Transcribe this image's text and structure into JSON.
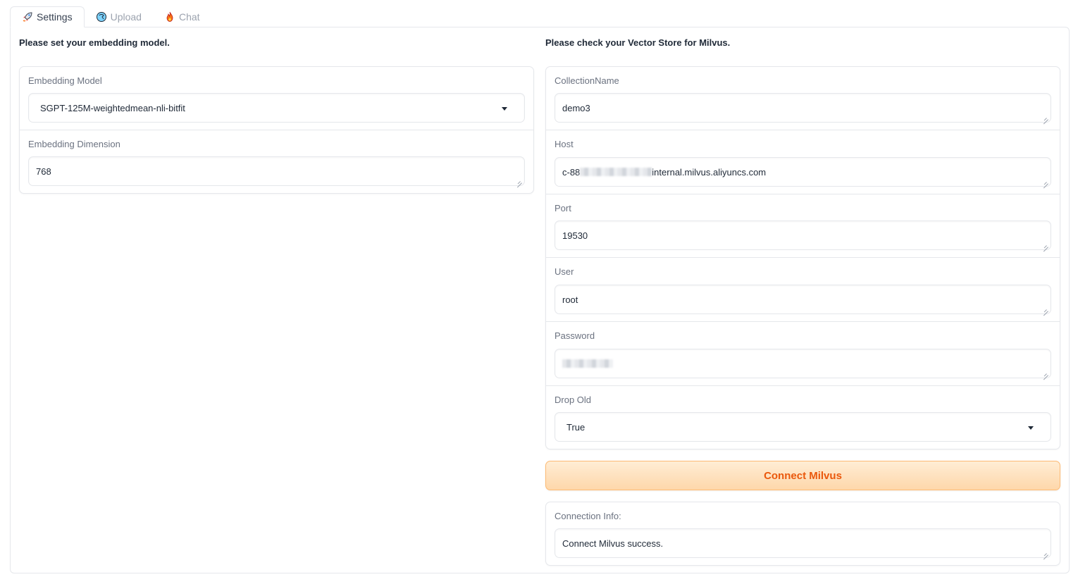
{
  "tabs": [
    {
      "label": "Settings",
      "icon": "rocket-icon",
      "active": true
    },
    {
      "label": "Upload",
      "icon": "upload-icon",
      "active": false
    },
    {
      "label": "Chat",
      "icon": "fire-icon",
      "active": false
    }
  ],
  "left": {
    "heading": "Please set your embedding model.",
    "embedding_model": {
      "label": "Embedding Model",
      "value": "SGPT-125M-weightedmean-nli-bitfit"
    },
    "embedding_dimension": {
      "label": "Embedding Dimension",
      "value": "768"
    }
  },
  "right": {
    "heading": "Please check your Vector Store for Milvus.",
    "collection_name": {
      "label": "CollectionName",
      "value": "demo3"
    },
    "host": {
      "label": "Host",
      "value_prefix": "c-88",
      "value_suffix": "internal.milvus.aliyuncs.com"
    },
    "port": {
      "label": "Port",
      "value": "19530"
    },
    "user": {
      "label": "User",
      "value": "root"
    },
    "password": {
      "label": "Password"
    },
    "drop_old": {
      "label": "Drop Old",
      "value": "True"
    },
    "connect_button": "Connect Milvus",
    "connection_info": {
      "label": "Connection Info:",
      "value": "Connect Milvus success."
    }
  },
  "colors": {
    "accent": "#ea580c",
    "button_bg": "#fed7aa",
    "border": "#e5e7eb"
  }
}
